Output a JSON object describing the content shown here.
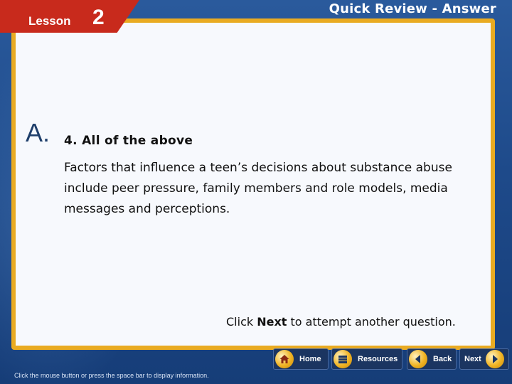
{
  "header": {
    "lesson_label": "Lesson",
    "lesson_number": "2",
    "title": "Quick Review - Answer"
  },
  "content": {
    "answer_letter": "A.",
    "answer_text": "4. All of the above",
    "explanation": "Factors that influence a teen’s decisions about substance abuse include peer pressure, family members and role models, media messages and perceptions.",
    "click_prefix": "Click",
    "click_bold": "Next",
    "click_suffix": "to attempt another question."
  },
  "footer": {
    "hint": "Click the mouse button or press the space bar to display information."
  },
  "nav": {
    "home": {
      "label": "Home",
      "icon": "home-icon"
    },
    "resources": {
      "label": "Resources",
      "icon": "resources-icon"
    },
    "back": {
      "label": "Back",
      "icon": "back-arrow-icon"
    },
    "next": {
      "label": "Next",
      "icon": "next-arrow-icon"
    }
  },
  "colors": {
    "background": "#1e4a8a",
    "panel_border": "#e9ab22",
    "lesson_tab": "#c82a1c",
    "nav_button": "#1b3561",
    "nav_icon": "#f0b322"
  }
}
